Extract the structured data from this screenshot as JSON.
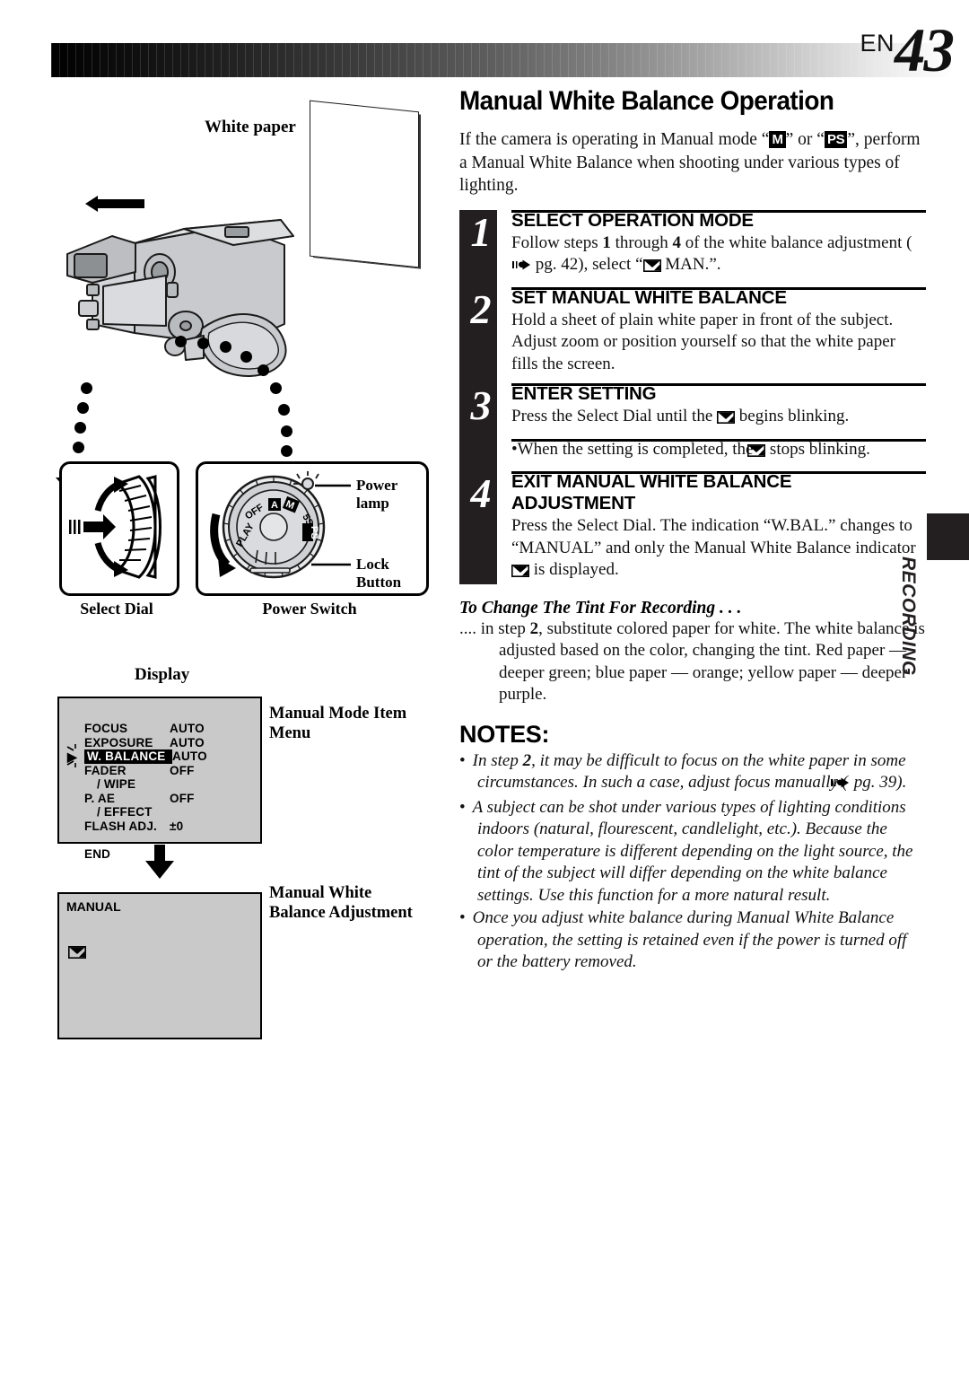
{
  "header": {
    "en_label": "EN",
    "page_number": "43"
  },
  "left_figure": {
    "white_paper_label": "White paper",
    "select_dial_caption": "Select Dial",
    "power_switch_caption": "Power Switch",
    "power_lamp_label": "Power lamp",
    "lock_button_label": "Lock Button",
    "dial_positions": [
      "PLAY",
      "OFF",
      "A",
      "M",
      "5S",
      "PS"
    ],
    "display_label": "Display",
    "manual_mode_item_menu_caption": "Manual Mode Item\nMenu",
    "manual_mode_item_menu_caption_l1": "Manual Mode Item",
    "manual_mode_item_menu_caption_l2": "Menu",
    "manual_wb_caption_l1": "Manual White",
    "manual_wb_caption_l2": "Balance Adjustment",
    "menu_rows": [
      {
        "label": "FOCUS",
        "value": "AUTO",
        "sub": false,
        "highlight": false
      },
      {
        "label": "EXPOSURE",
        "value": "AUTO",
        "sub": false,
        "highlight": false
      },
      {
        "label": "W. BALANCE",
        "value": "AUTO",
        "sub": false,
        "highlight": true
      },
      {
        "label": "FADER",
        "value": "OFF",
        "sub": false,
        "highlight": false
      },
      {
        "label": "/ WIPE",
        "value": "",
        "sub": true,
        "highlight": false
      },
      {
        "label": "P. AE",
        "value": "OFF",
        "sub": false,
        "highlight": false
      },
      {
        "label": "/ EFFECT",
        "value": "",
        "sub": true,
        "highlight": false
      },
      {
        "label": "FLASH ADJ.",
        "value": "±0",
        "sub": false,
        "highlight": false
      },
      {
        "label": "",
        "value": "",
        "sub": false,
        "highlight": false
      },
      {
        "label": "END",
        "value": "",
        "sub": false,
        "highlight": false
      }
    ],
    "screen2_text": "MANUAL"
  },
  "main": {
    "title": "Manual White Balance Operation",
    "intro_a": "If the camera is operating in Manual mode “",
    "intro_mode1": "M",
    "intro_b": "” or “",
    "intro_mode2": "PS",
    "intro_c": "”, perform a Manual White Balance when shooting under various types of lighting.",
    "steps": [
      {
        "number": "1",
        "heading": "SELECT OPERATION MODE",
        "body_a": "Follow steps ",
        "body_b1": "1",
        "body_b": " through ",
        "body_b2": "4",
        "body_c": " of the white balance adjustment (",
        "body_pg": " pg. 42), select “",
        "body_d": " MAN.”."
      },
      {
        "number": "2",
        "heading": "SET MANUAL WHITE BALANCE",
        "body": "Hold a sheet of plain white paper in front of the subject. Adjust zoom or position yourself so that the white paper fills the screen."
      },
      {
        "number": "3",
        "heading": "ENTER SETTING",
        "body_a": "Press the Select Dial until the ",
        "body_b": " begins blinking."
      },
      {
        "number": "4",
        "heading_l1": "EXIT MANUAL WHITE BALANCE",
        "heading_l2": "ADJUSTMENT",
        "body_a": "Press the Select Dial. The indication “W.BAL.” changes to “MANUAL” and only the Manual White Balance indicator ",
        "body_b": " is displayed."
      }
    ],
    "step3_bullet_a": "When the setting is completed, the ",
    "step3_bullet_b": " stops blinking.",
    "tint_heading": "To Change The Tint For Recording . . .",
    "tint_body_a": ".... in step ",
    "tint_body_num": "2",
    "tint_body_b": ", substitute colored paper for white. The white balance is adjusted based on the color, changing the tint. Red paper — deeper green; blue paper — orange; yellow paper — deeper purple.",
    "notes_heading": "NOTES:",
    "notes": [
      {
        "a": "In step ",
        "num": "2",
        "b": ", it may be difficult to focus on the white paper in some circumstances. In such a case, adjust focus manually (",
        "c": " pg. 39)."
      },
      {
        "a": "",
        "num": "",
        "b": "A subject can be shot under various types of lighting conditions indoors (natural, flourescent, candlelight, etc.). Because the color temperature is different depending on the light source, the tint of the subject will differ depending on the white balance settings. Use this function for a more natural result.",
        "c": ""
      },
      {
        "a": "",
        "num": "",
        "b": "Once you adjust white balance during Manual White Balance operation, the setting is retained even if the power is turned off or the battery removed.",
        "c": ""
      }
    ]
  },
  "side_tab": {
    "label": "RECORDING"
  },
  "colors": {
    "band": "#231f20",
    "screen_bg": "#c9c9c9",
    "ink": "#111111"
  }
}
